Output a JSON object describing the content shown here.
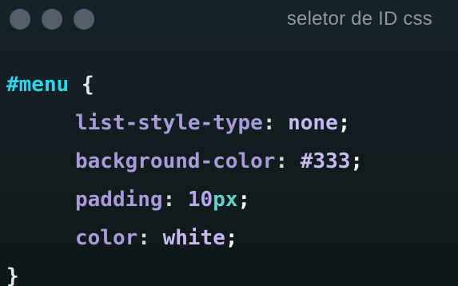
{
  "window": {
    "title": "seletor de ID css",
    "controls": [
      "close-dot",
      "minimize-dot",
      "maximize-dot"
    ]
  },
  "code": {
    "selector": "#menu",
    "open_brace": "{",
    "close_brace": "}",
    "declarations": [
      {
        "property": "list-style-type",
        "colon": ":",
        "value": "none",
        "semicolon": ";"
      },
      {
        "property": "background-color",
        "colon": ":",
        "value": "#333",
        "semicolon": ";"
      },
      {
        "property": "padding",
        "colon": ":",
        "value_number": "10",
        "value_unit": "px",
        "semicolon": ";"
      },
      {
        "property": "color",
        "colon": ":",
        "value": "white",
        "semicolon": ";"
      }
    ]
  },
  "colors": {
    "background": "#121c1f",
    "selector": "#2fd3ec",
    "property": "#a99ad9",
    "value": "#c9b9f2",
    "unit": "#62d1c9",
    "title": "#8f979c",
    "window_dot": "#55606a"
  }
}
